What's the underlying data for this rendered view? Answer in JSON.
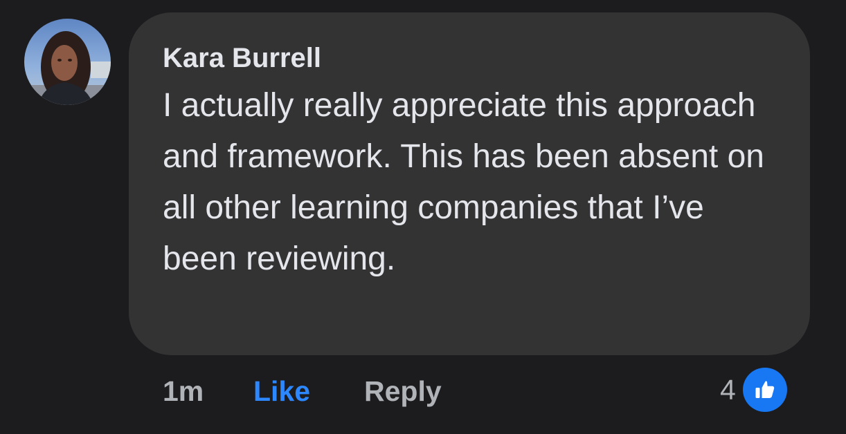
{
  "comment": {
    "author": "Kara Burrell",
    "text": "I actually really appreciate this approach and framework. This has been absent on all other learning companies that I’ve been reviewing.",
    "timestamp": "1m",
    "like_label": "Like",
    "reply_label": "Reply",
    "reaction_count": "4",
    "reaction_icon": "thumbs-up-icon",
    "avatar_icon": "user-avatar"
  },
  "colors": {
    "background": "#1c1c1e",
    "bubble": "#333334",
    "primary_text": "#e4e6eb",
    "secondary_text": "#b0b3b8",
    "like_blue": "#2d88ff",
    "reaction_blue": "#1877f2"
  }
}
